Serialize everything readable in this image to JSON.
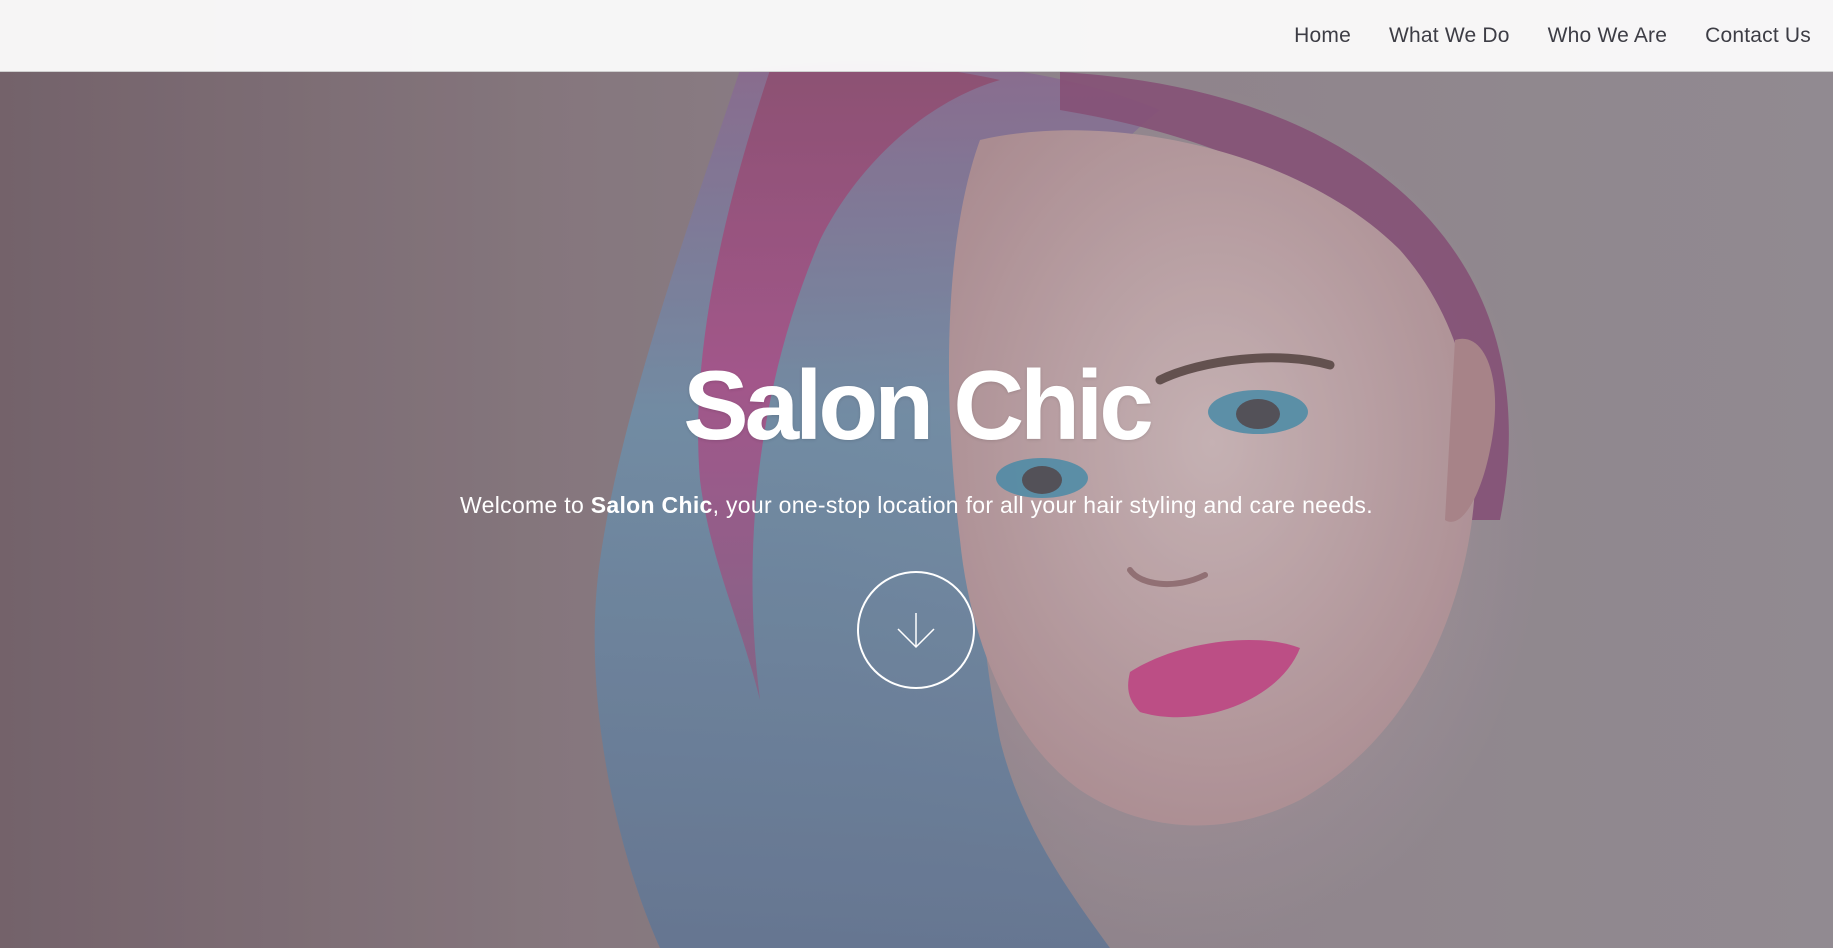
{
  "nav": {
    "items": [
      {
        "label": "Home"
      },
      {
        "label": "What We Do"
      },
      {
        "label": "Who We Are"
      },
      {
        "label": "Contact Us"
      }
    ]
  },
  "hero": {
    "title": "Salon Chic",
    "tagline_prefix": "Welcome to ",
    "tagline_brand": "Salon Chic",
    "tagline_suffix": ", your one-stop location for all your hair styling and care needs.",
    "scroll_icon": "arrow-down-icon"
  },
  "colors": {
    "nav_background": "#fafafa",
    "nav_text": "#3d3d45",
    "hero_text": "#ffffff",
    "lip_pink": "#e0569a",
    "hair_pink": "#c65a9e",
    "hair_blue": "#7fa7c4"
  }
}
